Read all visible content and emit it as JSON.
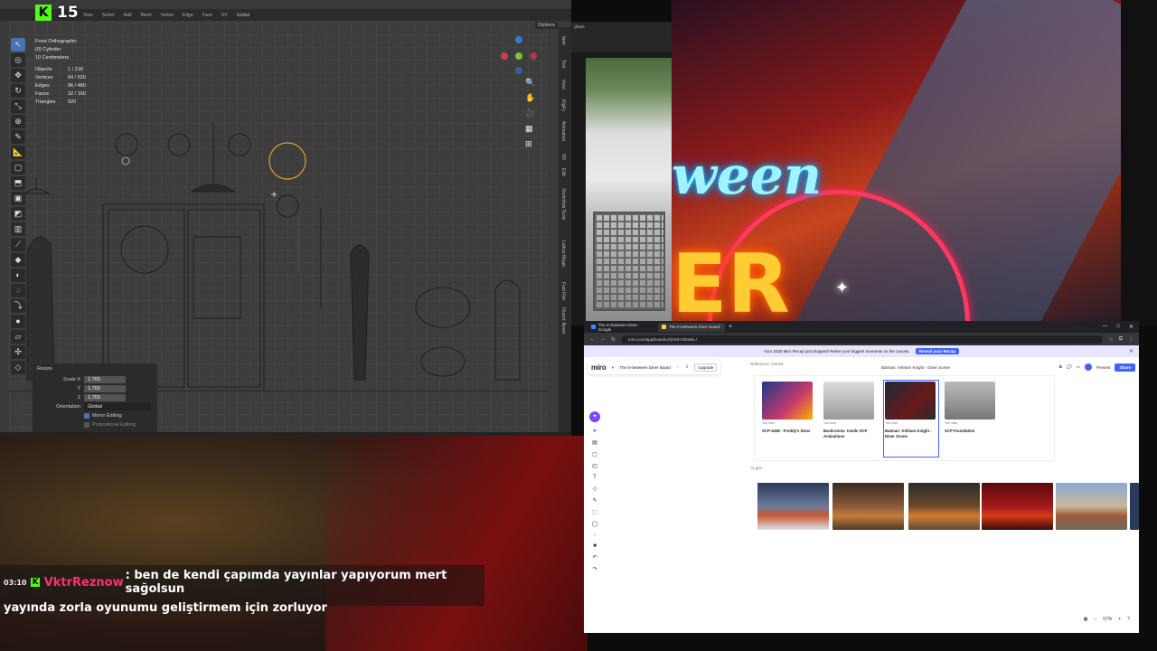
{
  "stream": {
    "kick_viewers": "15",
    "neon_word": "ween",
    "neon_big": "ER"
  },
  "blender": {
    "header_items": [
      "File",
      "Edit",
      "Render",
      "Window",
      "Help",
      "Layout",
      "Modeling",
      "Sculpting",
      "UV Editing",
      "Texture Paint",
      "Shading",
      "Animation",
      "Rendering",
      "Compositing"
    ],
    "toolbar_items": [
      "View",
      "Select",
      "Add",
      "Mesh",
      "Vertex",
      "Edge",
      "Face",
      "UV"
    ],
    "transform_orientation": "Global",
    "options_label": "Options",
    "overlay": {
      "view_name": "Front Orthographic",
      "object_name": "(0) Cylinder",
      "scale_note": "10 Centimeters",
      "stats": [
        {
          "k": "Objects",
          "v": "1 / 218"
        },
        {
          "k": "Vertices",
          "v": "64 / 520"
        },
        {
          "k": "Edges",
          "v": "96 / 480"
        },
        {
          "k": "Faces",
          "v": "32 / 160"
        },
        {
          "k": "Triangles",
          "v": "520"
        }
      ]
    },
    "sidebar_tabs": [
      "Item",
      "Tool",
      "View",
      "RigFy",
      "Animation",
      "VR",
      "Edit",
      "Sketchfab Tools",
      "Lattice Magic",
      "Fast Rim",
      "Fluent: Bevel"
    ],
    "redo_panel": {
      "title": "Resize",
      "scale_x_label": "Scale X",
      "scale_y_label": "Y",
      "scale_z_label": "Z",
      "scale_x": "1.765",
      "scale_y": "1.765",
      "scale_z": "1.765",
      "orientation_label": "Orientation",
      "orientation_value": "Global",
      "mirror_editing": "Mirror Editing",
      "proportional_editing": "Proportional Editing"
    }
  },
  "cam_panel": {
    "search_text": "glass"
  },
  "browser": {
    "tabs": [
      {
        "label": "The In-between Diner - Google",
        "active": false
      },
      {
        "label": "The In-between Diner Board",
        "active": true
      }
    ],
    "url": "miro.com/app/board/uXjVK0YZ8n68=/",
    "banner_text": "Your 2025 Miro Recap just dropped! Relive your biggest moments on the canvas.",
    "banner_button": "Reveal your Recap",
    "board_title": "The In-between Diner Board",
    "upgrade_label": "Upgrade",
    "present_label": "Present",
    "share_label": "Share",
    "zoom_level": "57%",
    "reference_label": "Reference, Görsel",
    "ai_label": "AI gen",
    "video_title_label": "Batman: Arkham Knight - Diner Scene",
    "cards": [
      {
        "title": "SCP-4258 - Freddy's Diner",
        "source": "YouTube"
      },
      {
        "title": "Backrooms: Inside SCP Animations",
        "source": "YouTube"
      },
      {
        "title": "Batman: Arkham Knight - Diner Scene",
        "source": "YouTube"
      },
      {
        "title": "SCP Foundation",
        "source": "The Wiki"
      }
    ]
  },
  "chat": {
    "time": "03:10",
    "username": "VktrReznow",
    "message_part1": ": ben de kendi çapımda yayınlar yapıyorum mert sağolsun",
    "message_part2": "yayında zorla oyunumu geliştirmem için zorluyor"
  }
}
